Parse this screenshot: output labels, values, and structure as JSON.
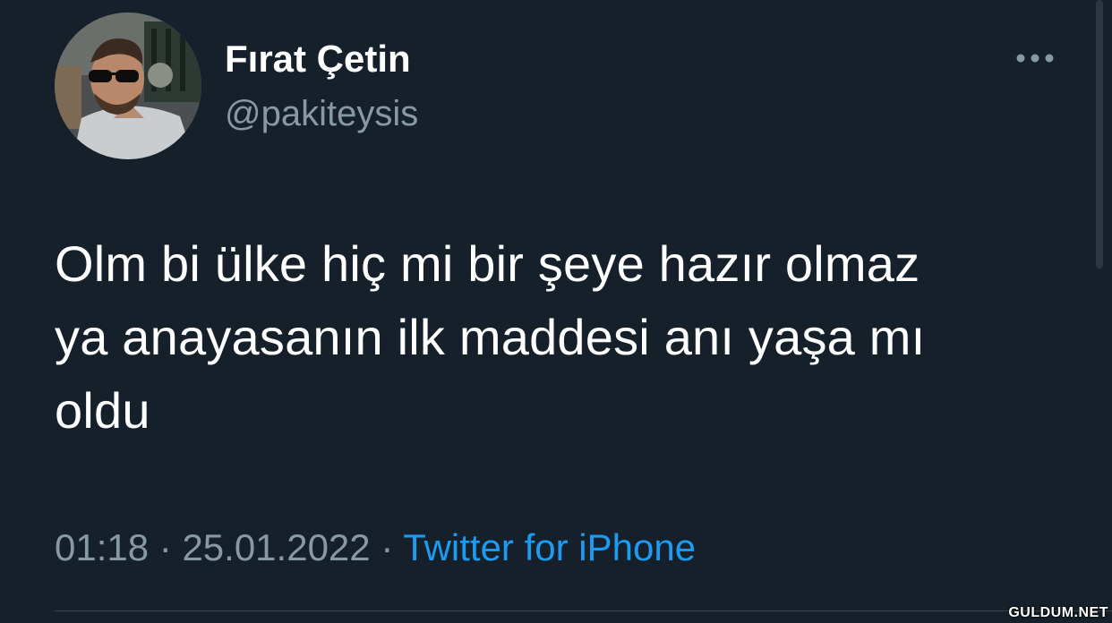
{
  "author": {
    "display_name": "Fırat Çetin",
    "handle": "@pakiteysis",
    "avatar": "profile-photo"
  },
  "tweet": {
    "line1": "Olm bi ülke hiç mi bir şeye hazır olmaz",
    "line2": "ya anayasanın ilk maddesi anı yaşa mı",
    "line3": "oldu"
  },
  "meta": {
    "time": "01:18",
    "separator": " · ",
    "date": "25.01.2022",
    "source": "Twitter for iPhone"
  },
  "actions": {
    "more_icon": "more-horizontal-icon"
  },
  "watermark": "GULDUM.NET",
  "colors": {
    "background": "#15202b",
    "text_primary": "#ffffff",
    "text_secondary": "#8899a6",
    "link": "#1d9bf0",
    "divider": "#38444d"
  }
}
